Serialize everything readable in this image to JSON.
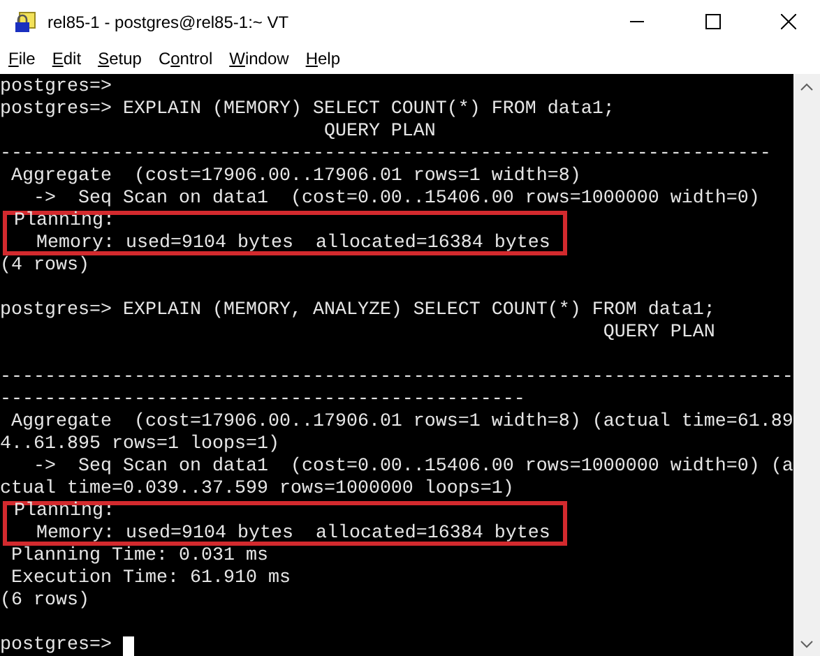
{
  "window": {
    "title": "rel85-1 - postgres@rel85-1:~ VT"
  },
  "menu": [
    {
      "mnemonic": "F",
      "rest": "ile"
    },
    {
      "mnemonic": "E",
      "rest": "dit"
    },
    {
      "mnemonic": "S",
      "rest": "etup"
    },
    {
      "prefix": "C",
      "mnemonic": "o",
      "rest": "ntrol"
    },
    {
      "mnemonic": "W",
      "rest": "indow"
    },
    {
      "mnemonic": "H",
      "rest": "elp"
    }
  ],
  "terminal": {
    "segments": [
      {
        "highlighted": false,
        "lines": [
          {
            "kind": "text",
            "text": "postgres=>"
          },
          {
            "kind": "text",
            "text": "postgres=> EXPLAIN (MEMORY) SELECT COUNT(*) FROM data1;"
          },
          {
            "kind": "text",
            "text": "                             QUERY PLAN"
          },
          {
            "kind": "text",
            "text": "---------------------------------------------------------------------"
          },
          {
            "kind": "text",
            "text": " Aggregate  (cost=17906.00..17906.01 rows=1 width=8)"
          },
          {
            "kind": "text",
            "text": "   ->  Seq Scan on data1  (cost=0.00..15406.00 rows=1000000 width=0)"
          }
        ]
      },
      {
        "highlighted": true,
        "lines": [
          {
            "kind": "text",
            "text": " Planning:"
          },
          {
            "kind": "text",
            "text": "   Memory: used=9104 bytes  allocated=16384 bytes"
          }
        ]
      },
      {
        "highlighted": false,
        "lines": [
          {
            "kind": "text",
            "text": "(4 rows)"
          },
          {
            "kind": "blank"
          },
          {
            "kind": "text",
            "text": "postgres=> EXPLAIN (MEMORY, ANALYZE) SELECT COUNT(*) FROM data1;"
          },
          {
            "kind": "text",
            "text": "                                                      QUERY PLAN"
          },
          {
            "kind": "blank"
          },
          {
            "kind": "text",
            "text": "-----------------------------------------------------------------------"
          },
          {
            "kind": "text",
            "text": "-----------------------------------------------"
          },
          {
            "kind": "text",
            "text": " Aggregate  (cost=17906.00..17906.01 rows=1 width=8) (actual time=61.89"
          },
          {
            "kind": "text",
            "text": "4..61.895 rows=1 loops=1)"
          },
          {
            "kind": "text",
            "text": "   ->  Seq Scan on data1  (cost=0.00..15406.00 rows=1000000 width=0) (a"
          },
          {
            "kind": "text",
            "text": "ctual time=0.039..37.599 rows=1000000 loops=1)"
          }
        ]
      },
      {
        "highlighted": true,
        "lines": [
          {
            "kind": "text",
            "text": " Planning:"
          },
          {
            "kind": "text",
            "text": "   Memory: used=9104 bytes  allocated=16384 bytes"
          }
        ]
      },
      {
        "highlighted": false,
        "lines": [
          {
            "kind": "text",
            "text": " Planning Time: 0.031 ms"
          },
          {
            "kind": "text",
            "text": " Execution Time: 61.910 ms"
          },
          {
            "kind": "text",
            "text": "(6 rows)"
          },
          {
            "kind": "blank"
          },
          {
            "kind": "prompt",
            "text": "postgres=> "
          }
        ]
      }
    ]
  }
}
